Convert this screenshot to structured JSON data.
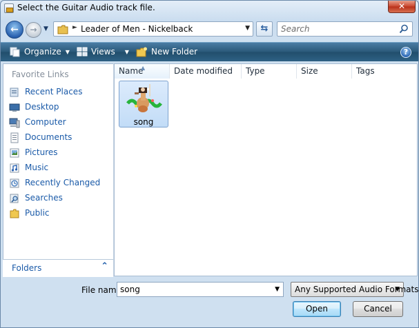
{
  "window": {
    "title": "Select the Guitar Audio track file.",
    "close_label": "✕"
  },
  "address": {
    "path": "Leader of Men - Nickelback",
    "search_placeholder": "Search"
  },
  "toolbar": {
    "organize_label": "Organize",
    "views_label": "Views",
    "new_folder_label": "New Folder"
  },
  "nav": {
    "header": "Favorite Links",
    "items": [
      {
        "label": "Recent Places",
        "icon": "recent-places-icon"
      },
      {
        "label": "Desktop",
        "icon": "desktop-icon"
      },
      {
        "label": "Computer",
        "icon": "computer-icon"
      },
      {
        "label": "Documents",
        "icon": "documents-icon"
      },
      {
        "label": "Pictures",
        "icon": "pictures-icon"
      },
      {
        "label": "Music",
        "icon": "music-icon"
      },
      {
        "label": "Recently Changed",
        "icon": "recently-changed-icon"
      },
      {
        "label": "Searches",
        "icon": "searches-icon"
      },
      {
        "label": "Public",
        "icon": "public-folder-icon"
      }
    ],
    "folders_label": "Folders"
  },
  "columns": [
    "Name",
    "Date modified",
    "Type",
    "Size",
    "Tags"
  ],
  "files": [
    {
      "name": "song"
    }
  ],
  "bottom": {
    "file_name_label": "File name:",
    "file_name_value": "song",
    "file_type": "Any Supported Audio Formats",
    "open_label": "Open",
    "cancel_label": "Cancel"
  }
}
